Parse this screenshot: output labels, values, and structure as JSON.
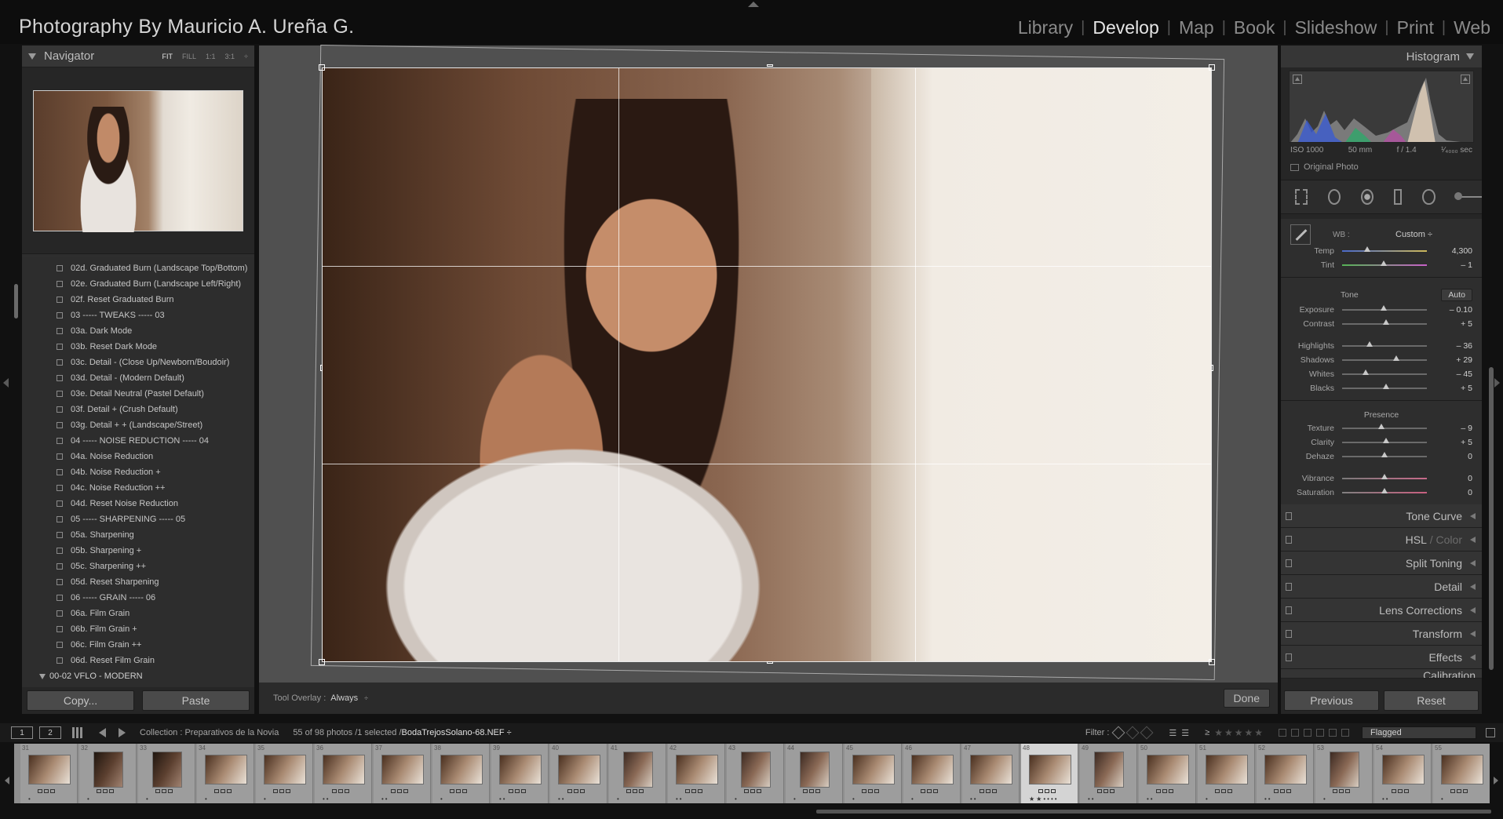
{
  "app": {
    "brand": "Photography By Mauricio A. Ureña  G.",
    "modules": [
      "Library",
      "Develop",
      "Map",
      "Book",
      "Slideshow",
      "Print",
      "Web"
    ],
    "active_module": "Develop"
  },
  "navigator": {
    "title": "Navigator",
    "zoom_options": [
      "FIT",
      "FILL",
      "1:1",
      "3:1"
    ],
    "zoom_selected": "FIT",
    "zoom_menu": "÷"
  },
  "presets": [
    "02d. Graduated Burn (Landscape Top/Bottom)",
    "02e. Graduated Burn (Landscape Left/Right)",
    "02f. Reset Graduated Burn",
    "03 ----- TWEAKS ----- 03",
    "03a. Dark Mode",
    "03b. Reset Dark Mode",
    "03c. Detail - (Close Up/Newborn/Boudoir)",
    "03d. Detail - (Modern Default)",
    "03e. Detail Neutral (Pastel Default)",
    "03f. Detail + (Crush Default)",
    "03g. Detail + + (Landscape/Street)",
    "04 ----- NOISE REDUCTION ----- 04",
    "04a. Noise Reduction",
    "04b. Noise Reduction +",
    "04c. Noise Reduction ++",
    "04d. Reset Noise Reduction",
    "05 ----- SHARPENING ----- 05",
    "05a. Sharpening",
    "05b. Sharpening +",
    "05c. Sharpening ++",
    "05d. Reset Sharpening",
    "06 ----- GRAIN ----- 06",
    "06a. Film Grain",
    "06b. Film Grain +",
    "06c. Film Grain ++",
    "06d. Reset Film Grain"
  ],
  "preset_folder": "00-02 VFLO - MODERN",
  "left_buttons": {
    "copy": "Copy...",
    "paste": "Paste"
  },
  "toolbar": {
    "overlay_label": "Tool Overlay :",
    "overlay_value": "Always",
    "overlay_menu": "÷",
    "done": "Done"
  },
  "histogram": {
    "title": "Histogram",
    "iso": "ISO 1000",
    "focal": "50 mm",
    "aperture": "f / 1.4",
    "shutter": "¹⁄₄₀₀₀ sec",
    "original_photo": "Original Photo"
  },
  "basic": {
    "wb_label": "WB :",
    "wb_value": "Custom ÷",
    "temp": {
      "label": "Temp",
      "value": "4,300",
      "pos": 0.3
    },
    "tint": {
      "label": "Tint",
      "value": "– 1",
      "pos": 0.49
    },
    "tone_label": "Tone",
    "auto": "Auto",
    "exposure": {
      "label": "Exposure",
      "value": "– 0.10",
      "pos": 0.49
    },
    "contrast": {
      "label": "Contrast",
      "value": "+ 5",
      "pos": 0.52
    },
    "highlights": {
      "label": "Highlights",
      "value": "– 36",
      "pos": 0.32
    },
    "shadows": {
      "label": "Shadows",
      "value": "+ 29",
      "pos": 0.64
    },
    "whites": {
      "label": "Whites",
      "value": "– 45",
      "pos": 0.28
    },
    "blacks": {
      "label": "Blacks",
      "value": "+ 5",
      "pos": 0.52
    },
    "presence_label": "Presence",
    "texture": {
      "label": "Texture",
      "value": "– 9",
      "pos": 0.46
    },
    "clarity": {
      "label": "Clarity",
      "value": "+ 5",
      "pos": 0.52
    },
    "dehaze": {
      "label": "Dehaze",
      "value": "0",
      "pos": 0.5
    },
    "vibrance": {
      "label": "Vibrance",
      "value": "0",
      "pos": 0.5
    },
    "saturation": {
      "label": "Saturation",
      "value": "0",
      "pos": 0.5
    }
  },
  "collapsed_panels": {
    "tone_curve": "Tone Curve",
    "hsl": "HSL",
    "color": "Color",
    "split_toning": "Split Toning",
    "detail": "Detail",
    "lens": "Lens Corrections",
    "transform": "Transform",
    "effects": "Effects",
    "calibration": "Calibration"
  },
  "right_buttons": {
    "previous": "Previous",
    "reset": "Reset"
  },
  "filmstrip_bar": {
    "monitor1": "1",
    "monitor2": "2",
    "collection": "Collection : Preparativos de la Novia",
    "count": "55 of 98 photos /1 selected /",
    "filename": "BodaTrejosSolano-68.NEF ÷",
    "filter_label": "Filter :",
    "rating_op": "≥",
    "stars": "★★★★★",
    "flagged": "Flagged"
  },
  "thumbnails": [
    {
      "n": "31",
      "t": "land",
      "dots": "•"
    },
    {
      "n": "32",
      "t": "port-dark",
      "dots": "•"
    },
    {
      "n": "33",
      "t": "port-dark",
      "dots": "•"
    },
    {
      "n": "34",
      "t": "land",
      "dots": "•"
    },
    {
      "n": "35",
      "t": "land",
      "dots": "•"
    },
    {
      "n": "36",
      "t": "land",
      "dots": "••"
    },
    {
      "n": "37",
      "t": "land",
      "dots": "••"
    },
    {
      "n": "38",
      "t": "land",
      "dots": "•"
    },
    {
      "n": "39",
      "t": "land",
      "dots": "••"
    },
    {
      "n": "40",
      "t": "land",
      "dots": "••"
    },
    {
      "n": "41",
      "t": "port",
      "dots": "•"
    },
    {
      "n": "42",
      "t": "land",
      "dots": "••"
    },
    {
      "n": "43",
      "t": "port",
      "dots": "•"
    },
    {
      "n": "44",
      "t": "port",
      "dots": "•"
    },
    {
      "n": "45",
      "t": "land",
      "dots": "•"
    },
    {
      "n": "46",
      "t": "land",
      "dots": "•"
    },
    {
      "n": "47",
      "t": "land",
      "dots": "••"
    },
    {
      "n": "48",
      "t": "land",
      "dots": "★★••••",
      "sel": true
    },
    {
      "n": "49",
      "t": "port",
      "dots": "••"
    },
    {
      "n": "50",
      "t": "land",
      "dots": "••"
    },
    {
      "n": "51",
      "t": "land",
      "dots": "•"
    },
    {
      "n": "52",
      "t": "land",
      "dots": "••"
    },
    {
      "n": "53",
      "t": "port",
      "dots": "•"
    },
    {
      "n": "54",
      "t": "land",
      "dots": "••"
    },
    {
      "n": "55",
      "t": "land",
      "dots": "•"
    }
  ]
}
